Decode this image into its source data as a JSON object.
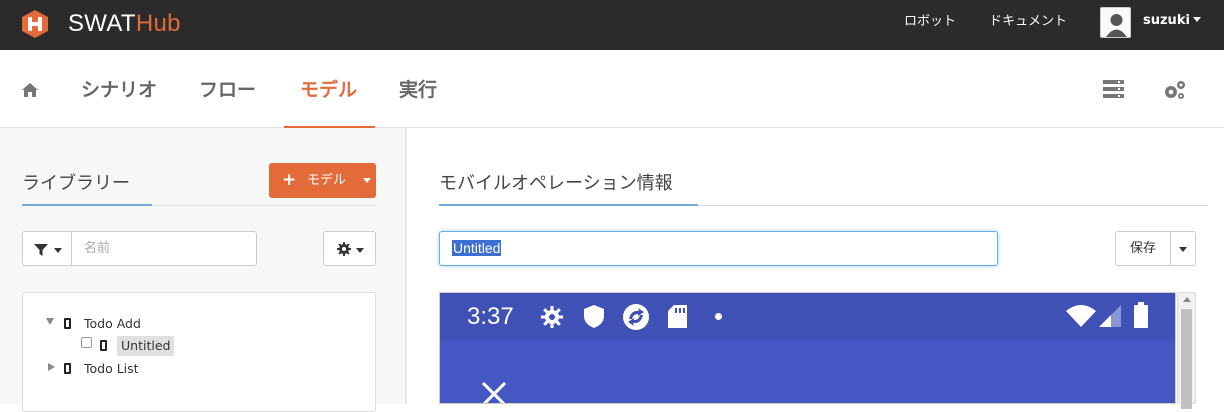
{
  "app": {
    "brand_main": "SWAT",
    "brand_accent": "Hub"
  },
  "header": {
    "links": [
      "ロボット",
      "ドキュメント"
    ],
    "user": "suzuki"
  },
  "nav": {
    "tabs": [
      "シナリオ",
      "フロー",
      "モデル",
      "実行"
    ],
    "active_tab": "モデル"
  },
  "library": {
    "title": "ライブラリー",
    "add_button": "モデル",
    "search_placeholder": "名前",
    "tree": [
      {
        "label": "Todo Add",
        "expanded": true,
        "children": [
          {
            "label": "Untitled",
            "selected": true
          }
        ]
      },
      {
        "label": "Todo List",
        "expanded": false
      }
    ]
  },
  "detail": {
    "title": "モバイルオペレーション情報",
    "name_value": "Untitled",
    "save_label": "保存"
  },
  "device": {
    "time": "3:37"
  },
  "colors": {
    "accent": "#e36b3a",
    "topbar": "#2b2b2b",
    "device_primary": "#3f51b5",
    "link_blue": "#74a8d8"
  }
}
